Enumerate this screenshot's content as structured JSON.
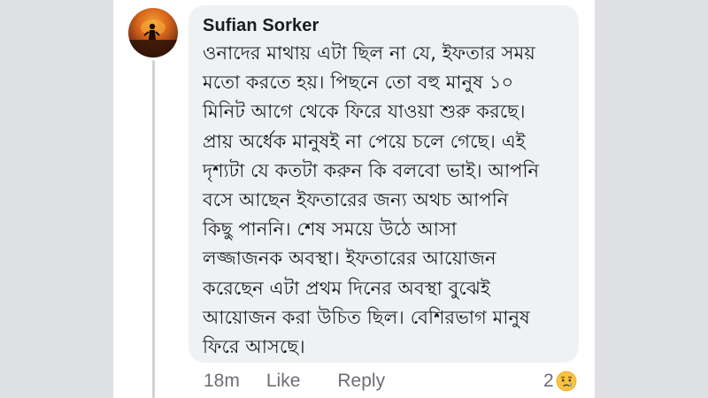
{
  "comment": {
    "author": "Sufian Sorker",
    "lines": [
      "ওনাদের মাথায় এটা ছিল না যে, ইফতার সময়",
      "মতো করতে হয়। পিছনে তো বহু মানুষ ১০",
      "মিনিট আগে থেকে ফিরে যাওয়া শুরু করছে।",
      "প্রায় অর্ধেক মানুষই না পেয়ে চলে গেছে। এই",
      "দৃশ্যটা যে কতটা করুন কি বলবো ভাই। আপনি",
      "বসে আছেন ইফতারের জন্য অথচ আপনি",
      "কিছু পাননি। শেষ  সময়ে উঠে আসা",
      "লজ্জাজনক অবস্থা। ইফতারের আয়োজন",
      "করেছেন এটা প্রথম দিনের অবস্থা বুঝেই",
      "আয়োজন করা উচিত ছিল। বেশিরভাগ মানুষ",
      "ফিরে আসছে।"
    ]
  },
  "actions": {
    "timestamp": "18m",
    "like_label": "Like",
    "reply_label": "Reply"
  },
  "reactions": {
    "count": "2",
    "icon": "sad-face-icon"
  },
  "colors": {
    "bubble": "#f0f1f4",
    "text": "#1a1b1e",
    "meta": "#6b6e74",
    "reaction": "#f7c340"
  }
}
